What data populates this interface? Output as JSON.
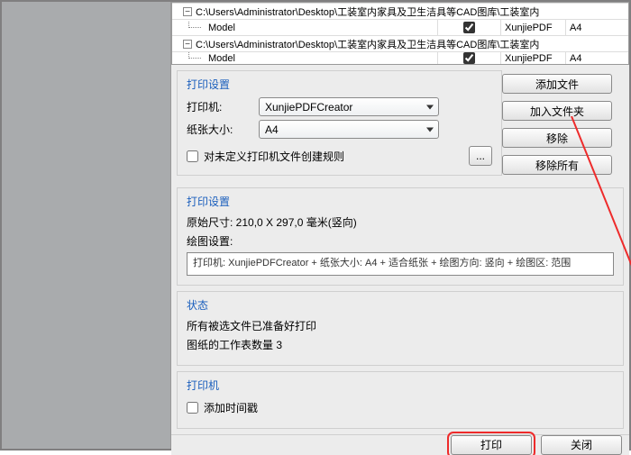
{
  "file_list": {
    "paths": [
      "C:\\Users\\Administrator\\Desktop\\工装室内家具及卫生洁具等CAD图库\\工装室内",
      "C:\\Users\\Administrator\\Desktop\\工装室内家具及卫生洁具等CAD图库\\工装室内"
    ],
    "sub_rows": [
      {
        "name": "Model",
        "checked": true,
        "app": "XunjiePDF",
        "page": "A4"
      },
      {
        "name": "Model",
        "checked": true,
        "app": "XunjiePDF",
        "page": "A4"
      }
    ]
  },
  "print_settings": {
    "group_title": "打印设置",
    "printer_label": "打印机:",
    "printer_value": "XunjiePDFCreator",
    "paper_label": "纸张大小:",
    "paper_value": "A4",
    "rule_checkbox": "对未定义打印机文件创建规则",
    "more_btn": "..."
  },
  "side_actions": {
    "add_file": "添加文件",
    "add_folder": "加入文件夹",
    "remove": "移除",
    "remove_all": "移除所有"
  },
  "print_info": {
    "group_title": "打印设置",
    "orig_size": "原始尺寸: 210,0 X 297,0 毫米(竖向)",
    "draw_label": "绘图设置:",
    "readout": "打印机: XunjiePDFCreator + 纸张大小: A4 + 适合纸张 + 绘图方向: 竖向 + 绘图区: 范围"
  },
  "status": {
    "group_title": "状态",
    "line1": "所有被选文件已准备好打印",
    "line2": "图纸的工作表数量 3"
  },
  "printer_group": {
    "group_title": "打印机",
    "add_timestamp": "添加时间戳"
  },
  "footer": {
    "print": "打印",
    "close": "关闭"
  }
}
